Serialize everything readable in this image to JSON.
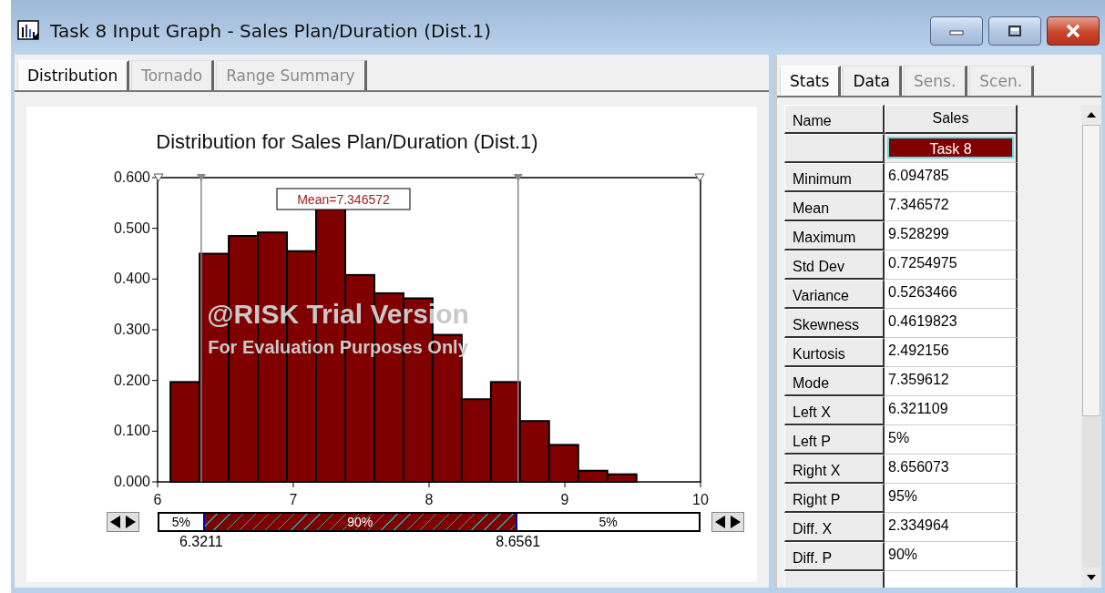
{
  "window": {
    "title": "Task 8 Input Graph - Sales Plan/Duration (Dist.1)"
  },
  "graph_tabs": [
    {
      "label": "Distribution",
      "selected": true,
      "disabled": false
    },
    {
      "label": "Tornado",
      "selected": false,
      "disabled": true
    },
    {
      "label": "Range Summary",
      "selected": false,
      "disabled": true
    }
  ],
  "chart": {
    "watermark": [
      "@RISK Trial Version",
      "For Evaluation Purposes Only"
    ],
    "chart_data": {
      "type": "bar",
      "title": "Distribution for Sales Plan/Duration (Dist.1)",
      "x": [
        6.2021,
        6.4167,
        6.6313,
        6.8459,
        7.0605,
        7.2751,
        7.4897,
        7.7043,
        7.9189,
        8.1335,
        8.3481,
        8.5627,
        8.7773,
        8.9919,
        9.2065,
        9.421
      ],
      "values": [
        0.197,
        0.45,
        0.485,
        0.492,
        0.455,
        0.54,
        0.408,
        0.372,
        0.362,
        0.29,
        0.163,
        0.197,
        0.12,
        0.073,
        0.022,
        0.015
      ],
      "color": "#800000",
      "xlim": [
        6,
        10
      ],
      "ylim": [
        0,
        0.6
      ],
      "xticks": [
        6,
        7,
        8,
        9,
        10
      ],
      "yticks": [
        {
          "value": 0,
          "label": "0.000"
        },
        {
          "value": 0.1,
          "label": "0.100"
        },
        {
          "value": 0.2,
          "label": "0.200"
        },
        {
          "value": 0.3,
          "label": "0.300"
        },
        {
          "value": 0.4,
          "label": "0.400"
        },
        {
          "value": 0.5,
          "label": "0.500"
        },
        {
          "value": 0.6,
          "label": "0.600"
        }
      ],
      "annotations": [
        "Mean=7.346572"
      ],
      "ref_lines": [
        {
          "axis": "x",
          "value": 6.3211
        },
        {
          "axis": "x",
          "value": 8.6561
        }
      ]
    }
  },
  "delimiter_bar": {
    "left_percent": "5%",
    "middle_percent": "90%",
    "right_percent": "5%",
    "left_value": "6.3211",
    "right_value": "8.6561"
  },
  "stats_tabs": [
    {
      "label": "Stats",
      "selected": true,
      "disabled": false
    },
    {
      "label": "Data",
      "selected": false,
      "disabled": false
    },
    {
      "label": "Sens.",
      "selected": false,
      "disabled": true
    },
    {
      "label": "Scen.",
      "selected": false,
      "disabled": true
    }
  ],
  "stats": {
    "columns": [
      "Name",
      "Sales"
    ],
    "series_label": "Task 8",
    "rows": [
      {
        "name": "Minimum",
        "value": "6.094785"
      },
      {
        "name": "Mean",
        "value": "7.346572"
      },
      {
        "name": "Maximum",
        "value": "9.528299"
      },
      {
        "name": "Std Dev",
        "value": "0.7254975"
      },
      {
        "name": "Variance",
        "value": "0.5263466"
      },
      {
        "name": "Skewness",
        "value": "0.4619823"
      },
      {
        "name": "Kurtosis",
        "value": "2.492156"
      },
      {
        "name": "Mode",
        "value": "7.359612"
      },
      {
        "name": "Left X",
        "value": "6.321109"
      },
      {
        "name": "Left P",
        "value": "5%"
      },
      {
        "name": "Right X",
        "value": "8.656073"
      },
      {
        "name": "Right P",
        "value": "95%"
      },
      {
        "name": "Diff. X",
        "value": "2.334964"
      },
      {
        "name": "Diff. P",
        "value": "90%"
      }
    ]
  }
}
